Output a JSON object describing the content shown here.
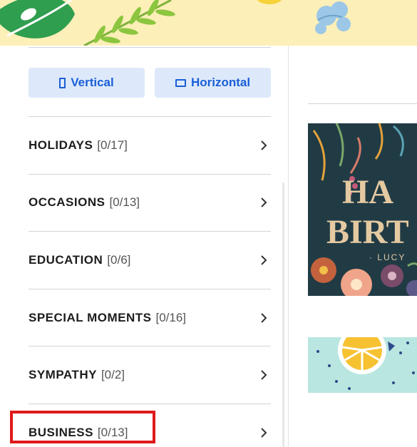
{
  "orientation": {
    "vertical_label": "Vertical",
    "horizontal_label": "Horizontal"
  },
  "categories": [
    {
      "name": "HOLIDAYS",
      "count": "[0/17]"
    },
    {
      "name": "OCCASIONS",
      "count": "[0/13]"
    },
    {
      "name": "EDUCATION",
      "count": "[0/6]"
    },
    {
      "name": "SPECIAL MOMENTS",
      "count": "[0/16]"
    },
    {
      "name": "SYMPATHY",
      "count": "[0/2]"
    },
    {
      "name": "BUSINESS",
      "count": "[0/13]"
    }
  ],
  "highlight_color": "#e01a1a",
  "accent_color": "#1a5fd6",
  "preview": {
    "card1_line1": "HA",
    "card1_line2": "BIRT",
    "card1_name": "· LUCY"
  }
}
